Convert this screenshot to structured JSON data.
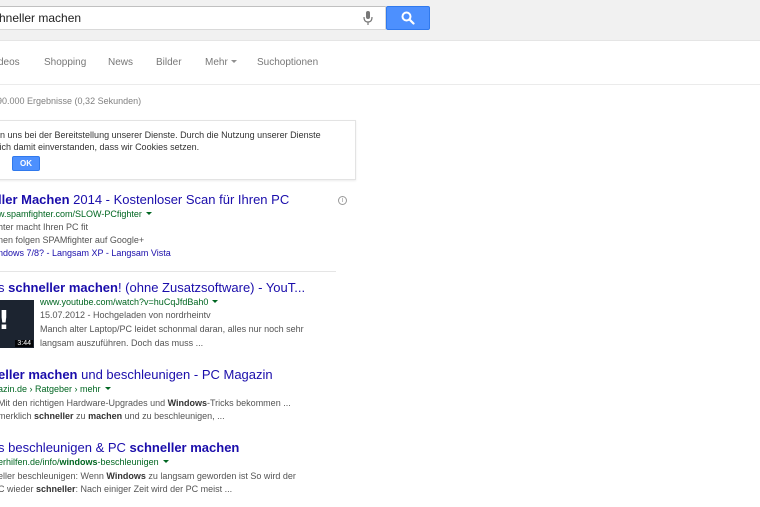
{
  "search": {
    "query": "chneller machen"
  },
  "tabs": [
    {
      "label": "deos"
    },
    {
      "label": "Shopping"
    },
    {
      "label": "News"
    },
    {
      "label": "Bilder"
    },
    {
      "label": "Mehr"
    },
    {
      "label": "Suchoptionen"
    }
  ],
  "stats": "90.000 Ergebnisse (0,32 Sekunden)",
  "cookie": {
    "line1": "en uns bei der Bereitstellung unserer Dienste. Durch die Nutzung unserer Dienste",
    "line2": "sich damit einverstanden, dass wir Cookies setzen.",
    "link": "n",
    "ok": "OK"
  },
  "results": [
    {
      "title_bold": "ller Machen",
      "title_rest": " 2014 - Kostenloser Scan für Ihren PC",
      "url": "w.spamfighter.com/SLOW-PCfighter",
      "line1": "hter macht Ihren PC fit",
      "line2": "nen folgen SPAMfighter auf Google+",
      "links": "ndows 7/8? - Langsam XP - Langsam Vista"
    },
    {
      "title_pre": "s ",
      "title_bold": "schneller machen",
      "title_rest": "! (ohne Zusatzsoftware) - YouT...",
      "url": "www.youtube.com/watch?v=huCqJfdBah0",
      "meta": "15.07.2012 - Hochgeladen von nordrheintv",
      "line1": "Manch alter Laptop/PC leidet schonmal daran, alles nur noch sehr",
      "line2": "langsam auszuführen. Doch das muss ...",
      "duration": "3:44"
    },
    {
      "title_bold": "eller machen",
      "title_rest": " und beschleunigen - PC Magazin",
      "url_pre": "azin.de › Ratgeber › mehr",
      "line1_a": " Mit den richtigen Hardware-Upgrades und ",
      "line1_b": "Windows",
      "line1_c": "-Tricks bekommen ...",
      "line2_a": " merklich ",
      "line2_b": "schneller",
      "line2_c": " zu ",
      "line2_d": "machen",
      "line2_e": " und zu beschleunigen, ..."
    },
    {
      "title_pre": "s beschleunigen & PC ",
      "title_bold": "schneller machen",
      "url_a": "erhilfen.de/info/",
      "url_b": "windows",
      "url_c": "-beschleunigen",
      "line1_a": "eller beschleunigen: Wenn ",
      "line1_b": "Windows",
      "line1_c": " zu langsam geworden ist So wird der",
      "line2_a": "C wieder ",
      "line2_b": "schneller",
      "line2_c": ": Nach einiger Zeit wird der PC meist ..."
    }
  ]
}
